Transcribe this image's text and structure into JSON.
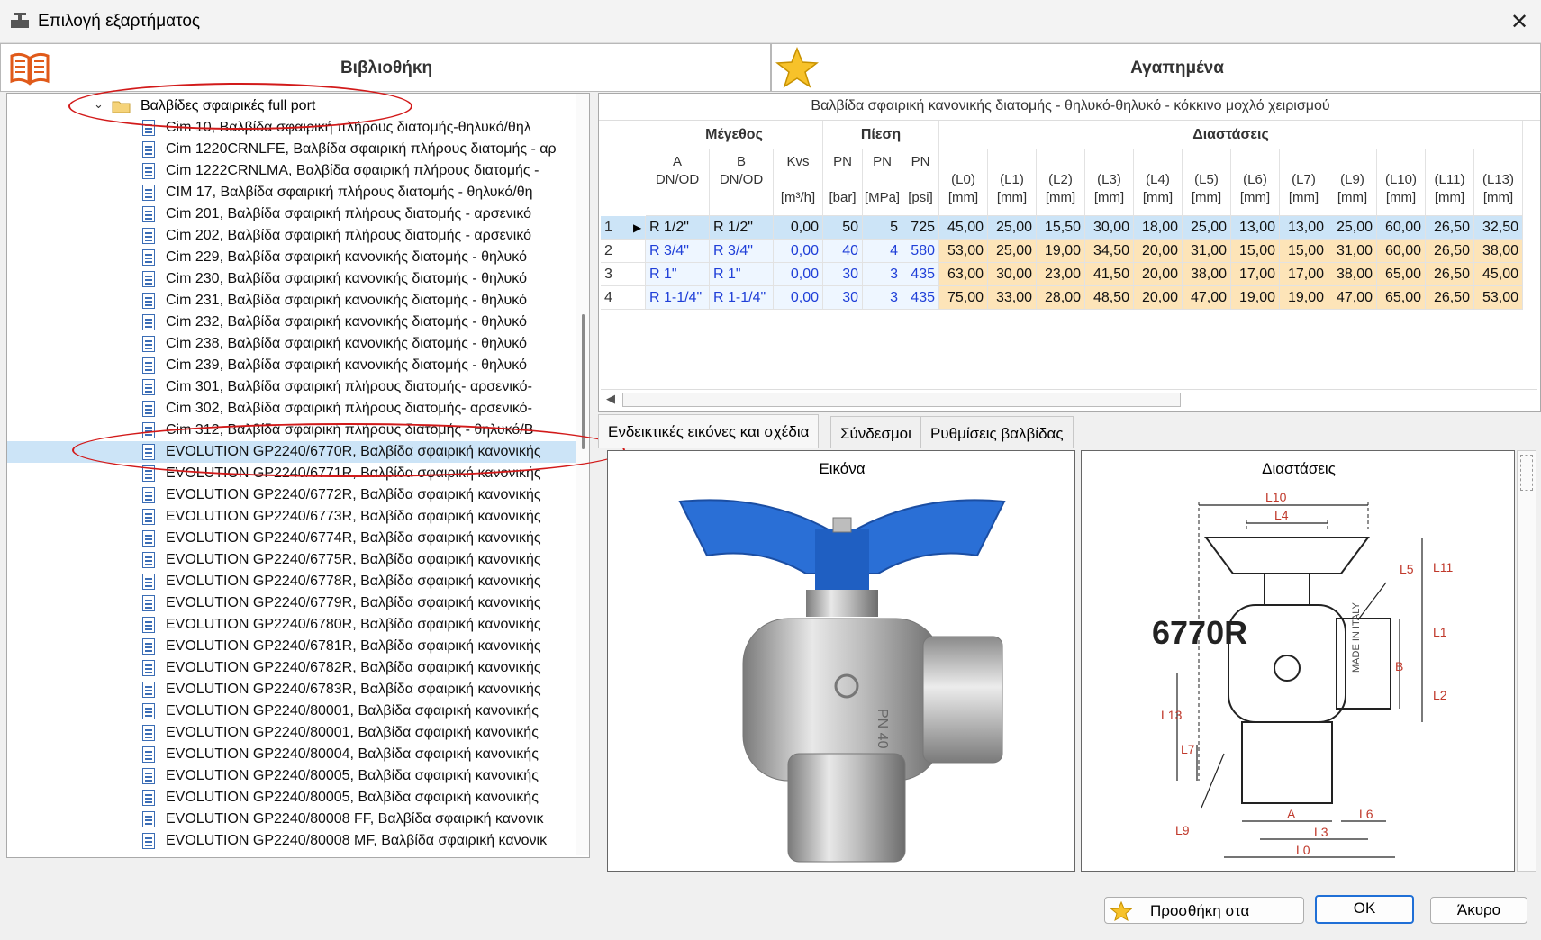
{
  "window": {
    "title": "Επιλογή εξαρτήματος",
    "close": "✕"
  },
  "library": {
    "header": "Βιβλιοθήκη"
  },
  "favorites": {
    "header": "Αγαπημένα"
  },
  "tree": {
    "folder": "Βαλβίδες σφαιρικές full port",
    "items": [
      "Cim 10, Βαλβίδα σφαιρική πλήρους διατομής-θηλυκό/θηλ",
      "Cim 1220CRNLFE, Βαλβίδα σφαιρική πλήρους διατομής - αρ",
      "Cim 1222CRNLMA, Βαλβίδα σφαιρική πλήρους διατομής - ",
      "CIM 17, Βαλβίδα σφαιρική πλήρους διατομής - θηλυκό/θη",
      "Cim 201, Βαλβίδα σφαιρική πλήρους διατομής - αρσενικό",
      "Cim 202, Βαλβίδα σφαιρική πλήρους διατομής - αρσενικό",
      "Cim 229, Βαλβίδα σφαιρική κανονικής διατομής - θηλυκό",
      "Cim 230, Βαλβίδα σφαιρική κανονικής διατομής - θηλυκό",
      "Cim 231, Βαλβίδα σφαιρική κανονικής διατομής - θηλυκό",
      "Cim 232, Βαλβίδα σφαιρική κανονικής διατομής - θηλυκό",
      "Cim 238, Βαλβίδα σφαιρική κανονικής διατομής - θηλυκό",
      "Cim 239, Βαλβίδα σφαιρική κανονικής διατομής - θηλυκό",
      "Cim 301, Βαλβίδα σφαιρική πλήρους διατομής- αρσενικό-",
      "Cim 302, Βαλβίδα σφαιρική πλήρους διατομής- αρσενικό-",
      "Cim 312, Βαλβίδα σφαιρική πλήρους διατομής - θηλυκό/Β",
      "EVOLUTION GP2240/6770R, Βαλβίδα σφαιρική κανονικής",
      "EVOLUTION GP2240/6771R, Βαλβίδα σφαιρική κανονικής",
      "EVOLUTION GP2240/6772R, Βαλβίδα σφαιρική κανονικής",
      "EVOLUTION GP2240/6773R, Βαλβίδα σφαιρική κανονικής",
      "EVOLUTION GP2240/6774R, Βαλβίδα σφαιρική κανονικής",
      "EVOLUTION GP2240/6775R, Βαλβίδα σφαιρική κανονικής",
      "EVOLUTION GP2240/6778R, Βαλβίδα σφαιρική κανονικής",
      "EVOLUTION GP2240/6779R, Βαλβίδα σφαιρική κανονικής",
      "EVOLUTION GP2240/6780R, Βαλβίδα σφαιρική κανονικής",
      "EVOLUTION GP2240/6781R, Βαλβίδα σφαιρική κανονικής",
      "EVOLUTION GP2240/6782R, Βαλβίδα σφαιρική κανονικής",
      "EVOLUTION GP2240/6783R, Βαλβίδα σφαιρική κανονικής",
      "EVOLUTION GP2240/80001, Βαλβίδα σφαιρική κανονικής",
      "EVOLUTION GP2240/80001, Βαλβίδα σφαιρική κανονικής",
      "EVOLUTION GP2240/80004, Βαλβίδα σφαιρική κανονικής",
      "EVOLUTION GP2240/80005, Βαλβίδα σφαιρική κανονικής",
      "EVOLUTION GP2240/80005, Βαλβίδα σφαιρική κανονικής",
      "EVOLUTION GP2240/80008 FF, Βαλβίδα σφαιρική κανονικ",
      "EVOLUTION GP2240/80008 MF, Βαλβίδα σφαιρική κανονικ"
    ]
  },
  "grid": {
    "caption": "Βαλβίδα σφαιρική κανονικής διατομής - θηλυκό-θηλυκό - κόκκινο μοχλό χειρισμού",
    "groups": [
      "Μέγεθος",
      "Πίεση",
      "Διαστάσεις"
    ],
    "columns": [
      {
        "top": "A",
        "mid": "DN/OD",
        "unit": ""
      },
      {
        "top": "B",
        "mid": "DN/OD",
        "unit": ""
      },
      {
        "top": "Kvs",
        "mid": "",
        "unit": "[m³/h]"
      },
      {
        "top": "PN",
        "mid": "",
        "unit": "[bar]"
      },
      {
        "top": "PN",
        "mid": "",
        "unit": "[MPa]"
      },
      {
        "top": "PN",
        "mid": "",
        "unit": "[psi]"
      },
      {
        "top": "",
        "mid": "(L0)",
        "unit": "[mm]"
      },
      {
        "top": "",
        "mid": "(L1)",
        "unit": "[mm]"
      },
      {
        "top": "",
        "mid": "(L2)",
        "unit": "[mm]"
      },
      {
        "top": "",
        "mid": "(L3)",
        "unit": "[mm]"
      },
      {
        "top": "",
        "mid": "(L4)",
        "unit": "[mm]"
      },
      {
        "top": "",
        "mid": "(L5)",
        "unit": "[mm]"
      },
      {
        "top": "",
        "mid": "(L6)",
        "unit": "[mm]"
      },
      {
        "top": "",
        "mid": "(L7)",
        "unit": "[mm]"
      },
      {
        "top": "",
        "mid": "(L9)",
        "unit": "[mm]"
      },
      {
        "top": "",
        "mid": "(L10)",
        "unit": "[mm]"
      },
      {
        "top": "",
        "mid": "(L11)",
        "unit": "[mm]"
      },
      {
        "top": "",
        "mid": "(L13)",
        "unit": "[mm]"
      }
    ],
    "rows": [
      {
        "n": "1",
        "cells": [
          "R 1/2\"",
          "R 1/2\"",
          "0,00",
          "50",
          "5",
          "725",
          "45,00",
          "25,00",
          "15,50",
          "30,00",
          "18,00",
          "25,00",
          "13,00",
          "13,00",
          "25,00",
          "60,00",
          "26,50",
          "32,50"
        ]
      },
      {
        "n": "2",
        "cells": [
          "R 3/4\"",
          "R 3/4\"",
          "0,00",
          "40",
          "4",
          "580",
          "53,00",
          "25,00",
          "19,00",
          "34,50",
          "20,00",
          "31,00",
          "15,00",
          "15,00",
          "31,00",
          "60,00",
          "26,50",
          "38,00"
        ]
      },
      {
        "n": "3",
        "cells": [
          "R 1\"",
          "R 1\"",
          "0,00",
          "30",
          "3",
          "435",
          "63,00",
          "30,00",
          "23,00",
          "41,50",
          "20,00",
          "38,00",
          "17,00",
          "17,00",
          "38,00",
          "65,00",
          "26,50",
          "45,00"
        ]
      },
      {
        "n": "4",
        "cells": [
          "R 1-1/4\"",
          "R 1-1/4\"",
          "0,00",
          "30",
          "3",
          "435",
          "75,00",
          "33,00",
          "28,00",
          "48,50",
          "20,00",
          "47,00",
          "19,00",
          "19,00",
          "47,00",
          "65,00",
          "26,50",
          "53,00"
        ]
      }
    ]
  },
  "tabs": [
    "Ενδεικτικές εικόνες και σχέδια",
    "Σύνδεσμοι",
    "Ρυθμίσεις βαλβίδας"
  ],
  "panels": {
    "image_title": "Εικόνα",
    "dims_title": "Διαστάσεις"
  },
  "drawing": {
    "model": "6770R",
    "labels": [
      "L10",
      "L4",
      "L5",
      "L11",
      "L1",
      "B",
      "L2",
      "L13",
      "L7",
      "L9",
      "A",
      "L6",
      "L3",
      "L0"
    ],
    "made_in": "MADE IN ITALY",
    "pn": "PN 40"
  },
  "buttons": {
    "add_favorites": "Προσθήκη στα",
    "ok": "OK",
    "cancel": "Άκυρο"
  },
  "colors": {
    "selected_row": "#cce4f7",
    "dim_cell": "#fde4b8",
    "value_blue": "#1f3fd8",
    "handle_blue": "#2a6fd6",
    "annotation_red": "#d21a1a"
  }
}
